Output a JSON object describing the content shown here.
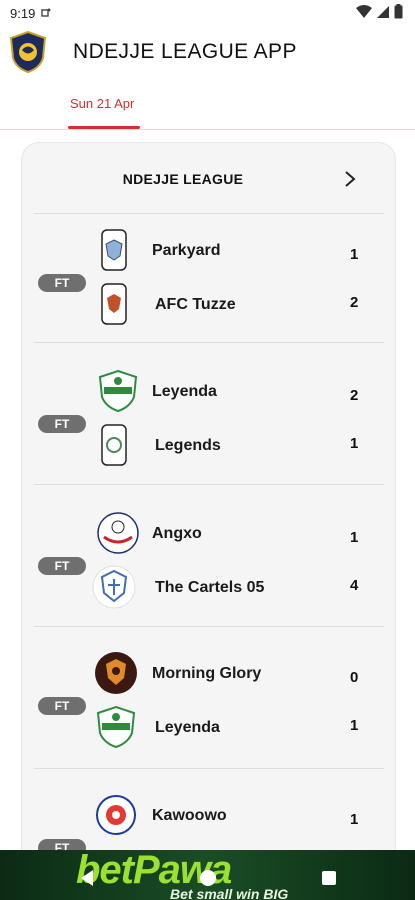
{
  "status_bar": {
    "time": "9:19"
  },
  "app": {
    "title": "NDEJJE LEAGUE APP"
  },
  "tabs": [
    {
      "label": "Sun 21 Apr",
      "active": true
    }
  ],
  "league": {
    "title": "NDEJJE LEAGUE"
  },
  "matches": [
    {
      "status": "FT",
      "home": {
        "name": "Parkyard",
        "score": "1"
      },
      "away": {
        "name": "AFC Tuzze",
        "score": "2"
      }
    },
    {
      "status": "FT",
      "home": {
        "name": "Leyenda",
        "score": "2"
      },
      "away": {
        "name": "Legends",
        "score": "1"
      }
    },
    {
      "status": "FT",
      "home": {
        "name": "Angxo",
        "score": "1"
      },
      "away": {
        "name": "The Cartels 05",
        "score": "4"
      }
    },
    {
      "status": "FT",
      "home": {
        "name": "Morning Glory",
        "score": "0"
      },
      "away": {
        "name": "Leyenda",
        "score": "1"
      }
    },
    {
      "status": "FT",
      "home": {
        "name": "Kawoowo",
        "score": "1"
      },
      "away": {
        "name": "",
        "score": ""
      }
    }
  ],
  "ad": {
    "brand": "betPawa",
    "tagline": "Bet small win BIG"
  },
  "colors": {
    "accent": "#d32f2f",
    "badge": "#6f6f6f",
    "card": "#f5f5f5",
    "ad_green": "#9be12f"
  }
}
